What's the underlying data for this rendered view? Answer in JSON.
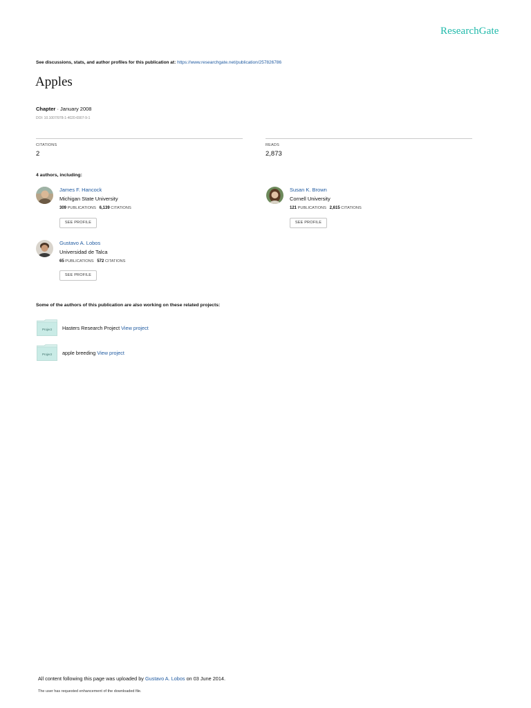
{
  "header": {
    "logo": "ResearchGate",
    "discuss_prefix": "See discussions, stats, and author profiles for this publication at:",
    "discuss_link": "https://www.researchgate.net/publication/257826786"
  },
  "publication": {
    "title": "Apples",
    "type": "Chapter",
    "separator": "·",
    "date": "January 2008",
    "doi": "DOI: 10.1007/978-1-4020-6907-9-1"
  },
  "stats": {
    "citations_label": "CITATIONS",
    "citations_value": "2",
    "reads_label": "READS",
    "reads_value": "2,873"
  },
  "authors_heading": "4 authors, including:",
  "authors": [
    {
      "name": "James F. Hancock",
      "institution": "Michigan State University",
      "publications": "309",
      "publications_label": "PUBLICATIONS",
      "citations": "6,139",
      "citations_label": "CITATIONS",
      "button": "SEE PROFILE"
    },
    {
      "name": "Susan K. Brown",
      "institution": "Cornell University",
      "publications": "121",
      "publications_label": "PUBLICATIONS",
      "citations": "2,615",
      "citations_label": "CITATIONS",
      "button": "SEE PROFILE"
    },
    {
      "name": "Gustavo A. Lobos",
      "institution": "Universidad de Talca",
      "publications": "65",
      "publications_label": "PUBLICATIONS",
      "citations": "572",
      "citations_label": "CITATIONS",
      "button": "SEE PROFILE"
    }
  ],
  "projects_heading": "Some of the authors of this publication are also working on these related projects:",
  "projects": [
    {
      "icon_label": "Project",
      "name": "Hasters Research Project",
      "link": "View project"
    },
    {
      "icon_label": "Project",
      "name": "apple breeding",
      "link": "View project"
    }
  ],
  "footer": {
    "uploaded_prefix": "All content following this page was uploaded by",
    "uploader": "Gustavo A. Lobos",
    "uploaded_suffix": "on 03 June 2014.",
    "note": "The user has requested enhancement of the downloaded file."
  },
  "colors": {
    "brand": "#1fb9aa",
    "link": "#1f5aa0",
    "folder": "#c9ebe6"
  }
}
